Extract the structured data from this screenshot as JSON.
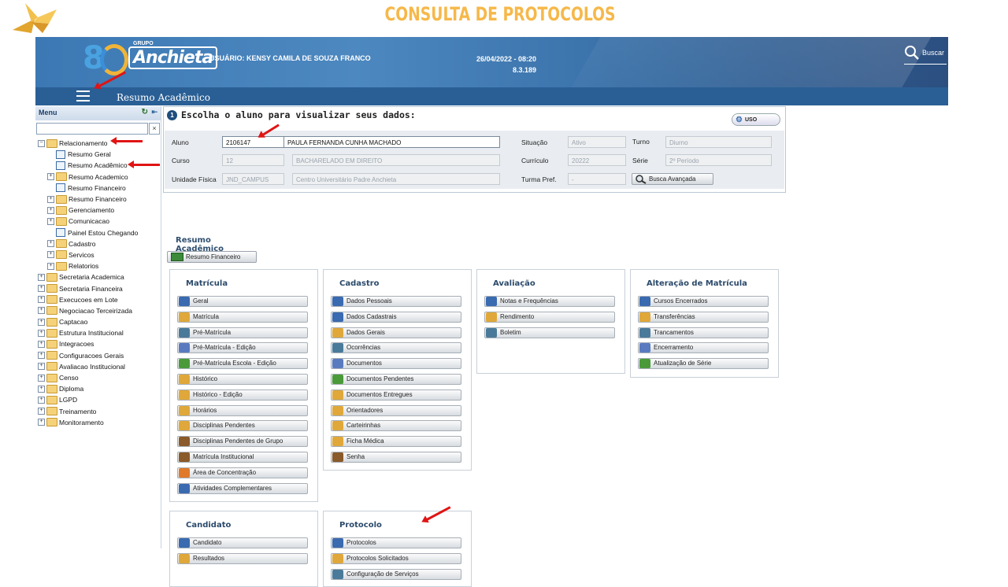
{
  "slide_title": "CONSULTA DE PROTOCOLOS",
  "header": {
    "brand_small": "GRUPO",
    "brand": "Anchieta",
    "logo_number": "8",
    "user_label": "USUÁRIO:",
    "user_name": "KENSY CAMILA DE SOUZA FRANCO",
    "date_time": "26/04/2022 - 08:20",
    "version": "8.3.189",
    "search_label": "Buscar"
  },
  "navbar": {
    "page_heading": "Resumo Acadêmico"
  },
  "sidebar": {
    "title": "Menu",
    "search_clear": "×",
    "items": [
      {
        "label": "Relacionamento",
        "level": 0,
        "type": "folder",
        "expand": "−"
      },
      {
        "label": "Resumo Geral",
        "level": 1,
        "type": "page"
      },
      {
        "label": "Resumo Acadêmico",
        "level": 1,
        "type": "page"
      },
      {
        "label": "Resumo Academico",
        "level": 1,
        "type": "folder",
        "expand": "+"
      },
      {
        "label": "Resumo Financeiro",
        "level": 1,
        "type": "page"
      },
      {
        "label": "Resumo Financeiro",
        "level": 1,
        "type": "folder",
        "expand": "+"
      },
      {
        "label": "Gerenciamento",
        "level": 1,
        "type": "folder",
        "expand": "+"
      },
      {
        "label": "Comunicacao",
        "level": 1,
        "type": "folder",
        "expand": "+"
      },
      {
        "label": "Painel Estou Chegando",
        "level": 1,
        "type": "page"
      },
      {
        "label": "Cadastro",
        "level": 1,
        "type": "folder",
        "expand": "+"
      },
      {
        "label": "Servicos",
        "level": 1,
        "type": "folder",
        "expand": "+"
      },
      {
        "label": "Relatorios",
        "level": 1,
        "type": "folder",
        "expand": "+"
      },
      {
        "label": "Secretaria Academica",
        "level": 0,
        "type": "folder",
        "expand": "+"
      },
      {
        "label": "Secretaria Financeira",
        "level": 0,
        "type": "folder",
        "expand": "+"
      },
      {
        "label": "Execucoes em Lote",
        "level": 0,
        "type": "folder",
        "expand": "+"
      },
      {
        "label": "Negociacao Terceirizada",
        "level": 0,
        "type": "folder",
        "expand": "+"
      },
      {
        "label": "Captacao",
        "level": 0,
        "type": "folder",
        "expand": "+"
      },
      {
        "label": "Estrutura Institucional",
        "level": 0,
        "type": "folder",
        "expand": "+"
      },
      {
        "label": "Integracoes",
        "level": 0,
        "type": "folder",
        "expand": "+"
      },
      {
        "label": "Configuracoes Gerais",
        "level": 0,
        "type": "folder",
        "expand": "+"
      },
      {
        "label": "Avaliacao Institucional",
        "level": 0,
        "type": "folder",
        "expand": "+"
      },
      {
        "label": "Censo",
        "level": 0,
        "type": "folder",
        "expand": "+"
      },
      {
        "label": "Diploma",
        "level": 0,
        "type": "folder",
        "expand": "+"
      },
      {
        "label": "LGPD",
        "level": 0,
        "type": "folder",
        "expand": "+"
      },
      {
        "label": "Treinamento",
        "level": 0,
        "type": "folder",
        "expand": "+"
      },
      {
        "label": "Monitoramento",
        "level": 0,
        "type": "folder",
        "expand": "+"
      }
    ]
  },
  "student_panel": {
    "step": "1",
    "title": "Escolha o aluno para visualizar seus dados:",
    "uso_label": "USO",
    "aluno_label": "Aluno",
    "aluno_code": "2106147",
    "aluno_name": "PAULA FERNANDA CUNHA MACHADO",
    "situacao_label": "Situação",
    "situacao": "Ativo",
    "turno_label": "Turno",
    "turno": "Diurno",
    "curso_label": "Curso",
    "curso_code": "12",
    "curso_name": "BACHARELADO EM DIREITO",
    "curriculo_label": "Currículo",
    "curriculo": "20222",
    "serie_label": "Série",
    "serie": "2º Período",
    "unidade_label": "Unidade Física",
    "unidade_code": "JND_CAMPUS",
    "unidade_name": "Centro Universitário Padre Anchieta",
    "turma_label": "Turma Pref.",
    "turma": "-",
    "busca_label": "Busca Avançada"
  },
  "resumo": {
    "title": "Resumo Acadêmico",
    "financeiro_button": "Resumo Financeiro"
  },
  "groups": {
    "matricula": {
      "title": "Matrícula",
      "buttons": [
        "Geral",
        "Matrícula",
        "Pré-Matrícula",
        "Pré-Matrícula - Edição",
        "Pré-Matrícula Escola - Edição",
        "Histórico",
        "Histórico - Edição",
        "Horários",
        "Disciplinas Pendentes",
        "Disciplinas Pendentes de Grupo",
        "Matrícula Institucional",
        "Área de Concentração",
        "Atividades Complementares"
      ]
    },
    "cadastro": {
      "title": "Cadastro",
      "buttons": [
        "Dados Pessoais",
        "Dados Cadastrais",
        "Dados Gerais",
        "Ocorrências",
        "Documentos",
        "Documentos Pendentes",
        "Documentos Entregues",
        "Orientadores",
        "Carteirinhas",
        "Ficha Médica",
        "Senha"
      ]
    },
    "avaliacao": {
      "title": "Avaliação",
      "buttons": [
        "Notas e Frequências",
        "Rendimento",
        "Boletim"
      ]
    },
    "alteracao": {
      "title": "Alteração de Matrícula",
      "buttons": [
        "Cursos Encerrados",
        "Transferências",
        "Trancamentos",
        "Encerramento",
        "Atualização de Série"
      ]
    },
    "candidato": {
      "title": "Candidato",
      "buttons": [
        "Candidato",
        "Resultados"
      ]
    },
    "protocolo": {
      "title": "Protocolo",
      "buttons": [
        "Protocolos",
        "Protocolos Solicitados",
        "Configuração de Serviços"
      ]
    }
  },
  "colors": {
    "accent_title": "#f6b84a",
    "header_blue": "#3c78b3",
    "nav_blue": "#2a5f95",
    "arrow_red": "#e01414"
  }
}
